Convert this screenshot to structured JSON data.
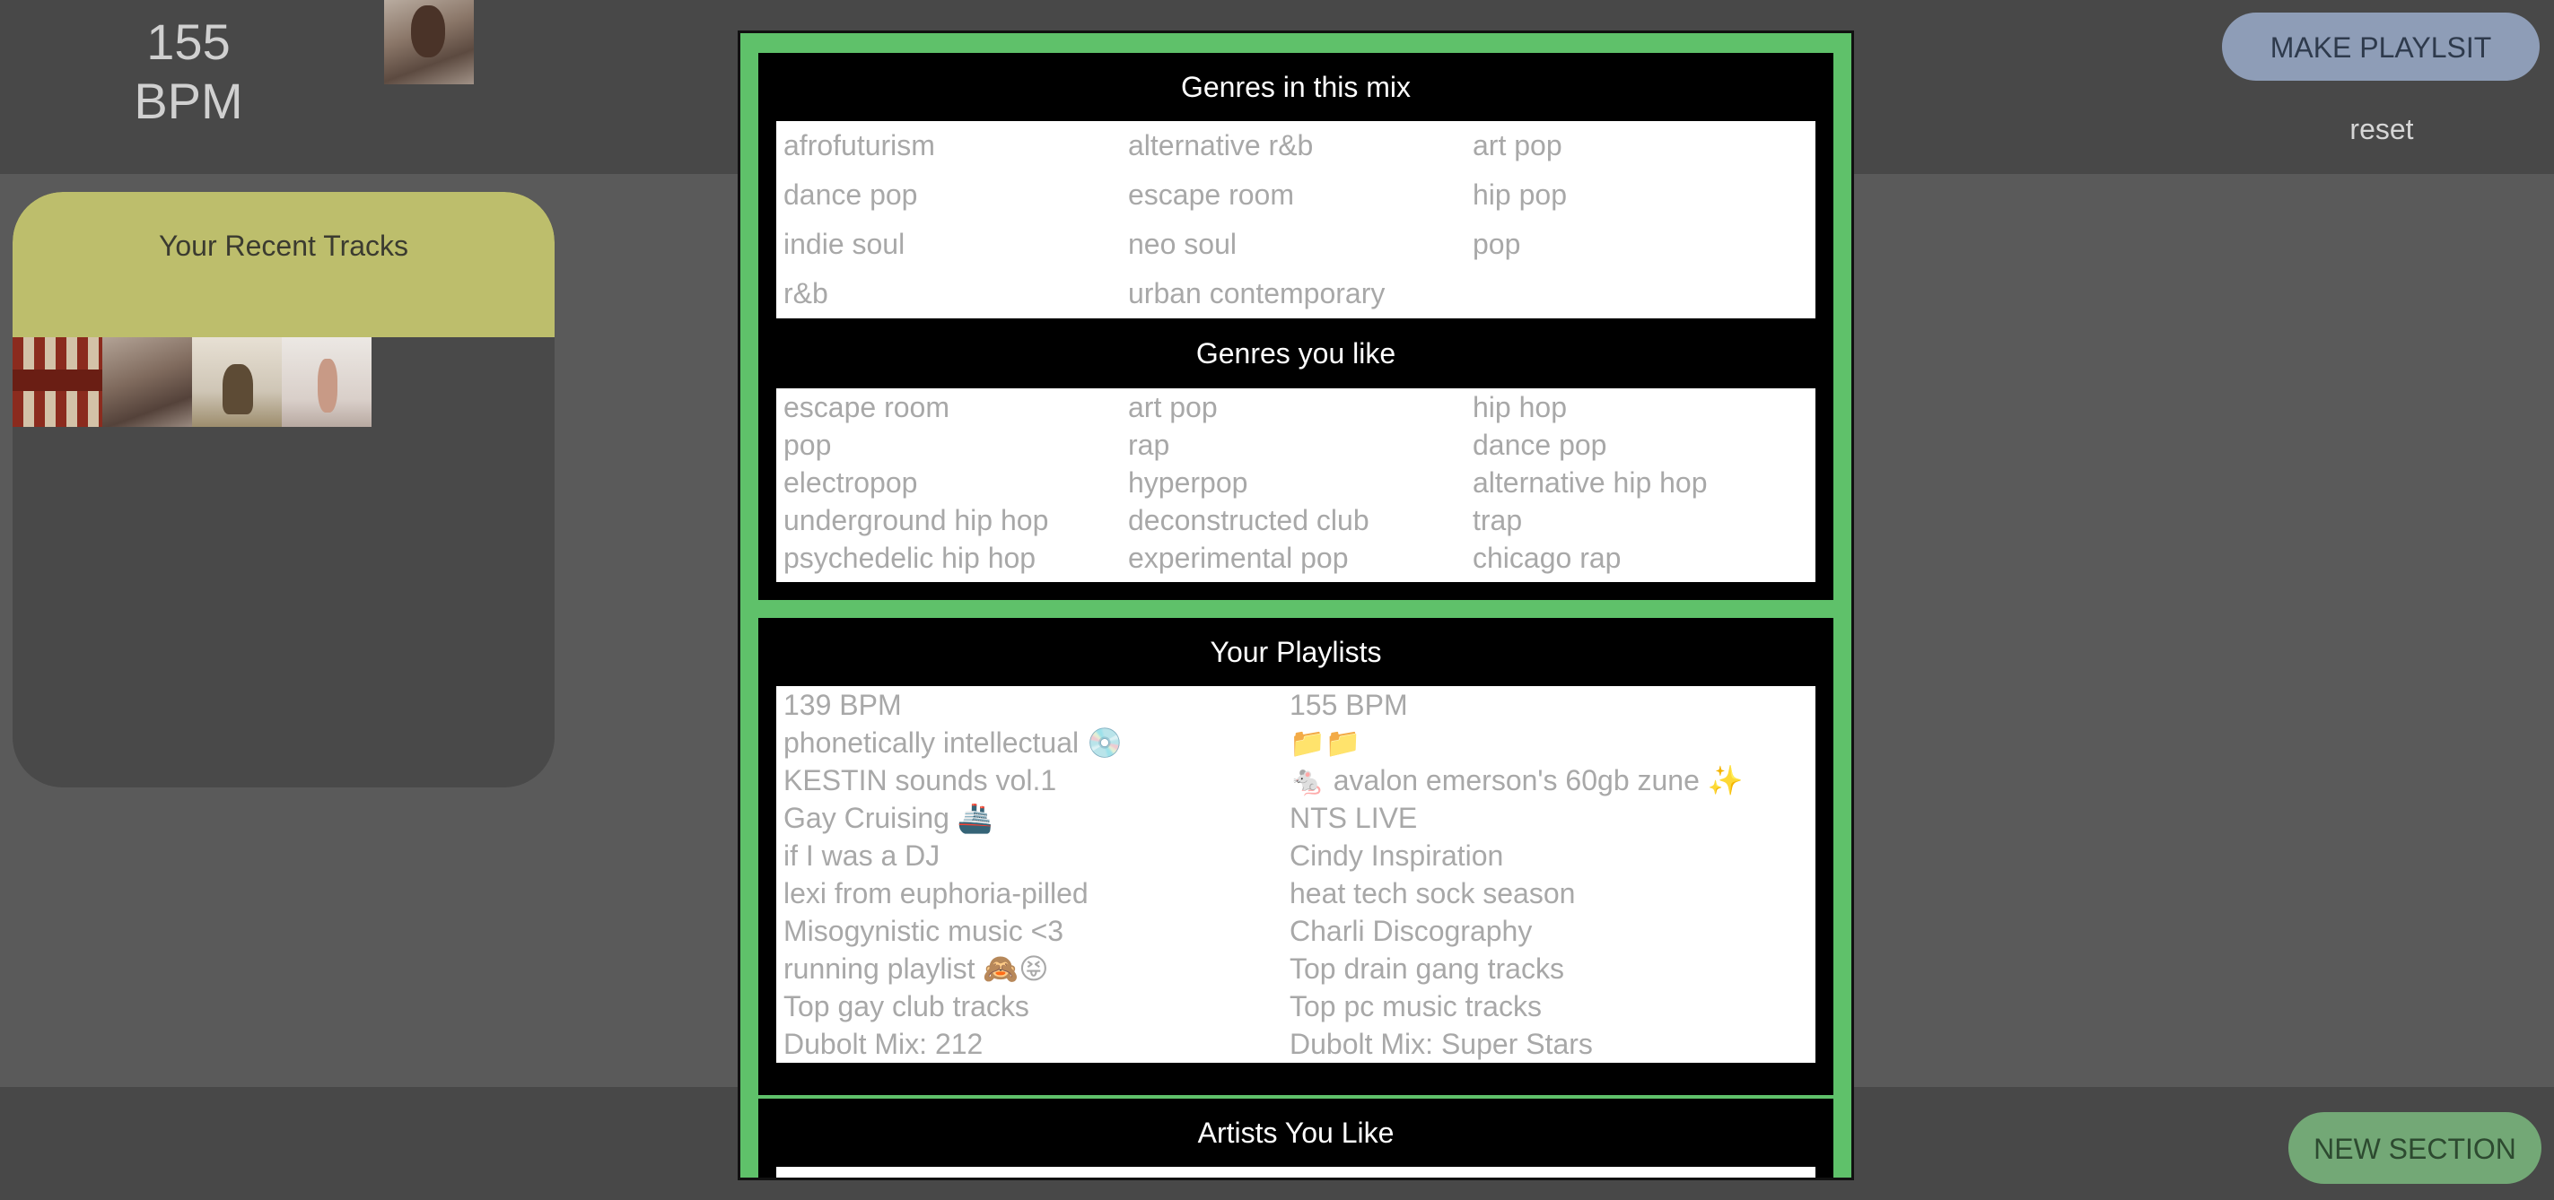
{
  "header": {
    "bpm_value": "155",
    "bpm_unit": "BPM",
    "make_playlist_label": "MAKE PLAYLSIT",
    "reset_label": "reset"
  },
  "recent_tracks": {
    "title": "Your Recent Tracks"
  },
  "modal": {
    "genres_mix": {
      "title": "Genres in this mix",
      "items": [
        "afrofuturism",
        "alternative r&b",
        "art pop",
        "dance pop",
        "escape room",
        "hip pop",
        "indie soul",
        "neo soul",
        "pop",
        "r&b",
        "urban contemporary"
      ]
    },
    "genres_like": {
      "title": "Genres you like",
      "items": [
        "escape room",
        "art pop",
        "hip hop",
        "pop",
        "rap",
        "dance pop",
        "electropop",
        "hyperpop",
        "alternative hip hop",
        "underground hip hop",
        "deconstructed club",
        "trap",
        "psychedelic hip hop",
        "experimental pop",
        "chicago rap"
      ]
    },
    "playlists": {
      "title": "Your Playlists",
      "items": [
        "139 BPM",
        "155 BPM",
        "phonetically intellectual 💿",
        "📁📁",
        "KESTIN sounds vol.1",
        "🐁 avalon emerson's 60gb zune ✨",
        "Gay Cruising 🚢",
        "NTS LIVE",
        "if I was a DJ",
        "Cindy Inspiration",
        "lexi from euphoria-pilled",
        "heat tech sock season",
        "Misogynistic music <3",
        "Charli Discography",
        "running playlist 🙈😝",
        "Top drain gang tracks",
        "Top gay club tracks",
        "Top pc music tracks",
        "Dubolt Mix: 212",
        "Dubolt Mix: Super Stars"
      ]
    },
    "artists": {
      "title": "Artists You Like"
    }
  },
  "footer": {
    "new_section_label": "NEW SECTION"
  }
}
